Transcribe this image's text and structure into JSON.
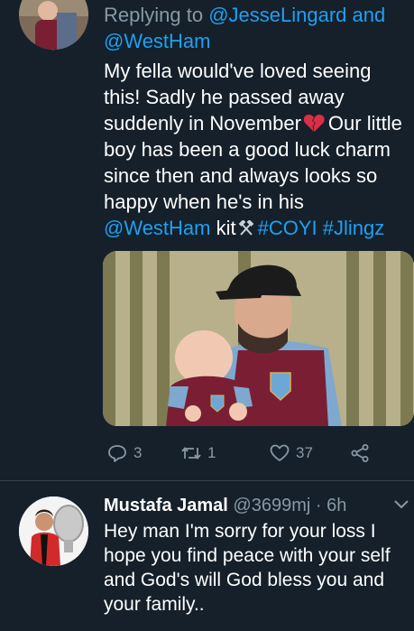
{
  "tweet1": {
    "replying_prefix": "Replying to",
    "replying_users": [
      "@JesseLingard",
      "and",
      "@WestHam"
    ],
    "text_part1": "My fella would've loved seeing this! Sadly he passed away suddenly in November",
    "text_part2": "Our little boy has been a good luck charm since then and always looks so happy when he's in his",
    "mention": "@WestHam",
    "text_part3": "kit",
    "hashtag1": "#COYI",
    "hashtag2": "#Jlingz",
    "emoji": "broken-heart-emoji",
    "photo_alt": "Father holding baby, both wearing West Ham kits",
    "stats": {
      "replies": "3",
      "retweets": "1",
      "likes": "37"
    }
  },
  "tweet2": {
    "name": "Mustafa Jamal",
    "handle": "@3699mj",
    "separator": "·",
    "time": "6h",
    "text": "Hey man I'm sorry for your loss I hope you find peace with your self and God's will God bless you and your family.."
  },
  "colors": {
    "background": "#15202b",
    "link": "#1da1f2",
    "secondary_text": "#8899a6",
    "divider": "#38444d"
  },
  "icons": [
    "reply-icon",
    "retweet-icon",
    "like-icon",
    "share-icon",
    "hammers-icon",
    "chevron-down-icon"
  ]
}
